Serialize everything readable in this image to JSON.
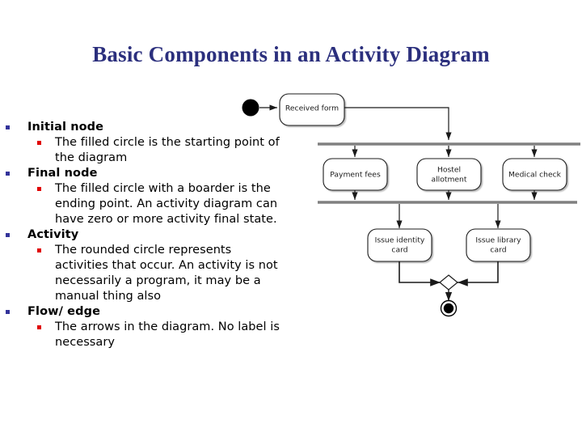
{
  "slide": {
    "title": "Basic Components in an Activity Diagram",
    "title_color": "#2b2f7d",
    "background_color": "#ffffff"
  },
  "bullets": {
    "marker_level1_color": "#33339a",
    "marker_level2_color": "#e00000",
    "items": [
      {
        "heading": "Initial node",
        "detail": "The filled circle is the starting point of the diagram"
      },
      {
        "heading": "Final node",
        "detail": "The filled circle with a boarder is the ending point. An activity diagram can have zero or more activity final state."
      },
      {
        "heading": "Activity",
        "detail": "The rounded circle represents activities that occur. An activity is not necessarily a program, it may be a manual thing also"
      },
      {
        "heading": "Flow/ edge",
        "detail": "The arrows in the diagram. No label is necessary"
      }
    ]
  },
  "diagram": {
    "type": "uml-activity-diagram",
    "stroke_color": "#1a1a1a",
    "bar_color": "#808080",
    "node_fill": "#ffffff",
    "initial_node": {
      "label": "",
      "shape": "filled-circle"
    },
    "final_node": {
      "label": "",
      "shape": "circle-with-border"
    },
    "merge_node": {
      "label": "",
      "shape": "diamond"
    },
    "fork_bar": {
      "label": "fork"
    },
    "join_bar": {
      "label": "join"
    },
    "activities": [
      {
        "id": "received-form",
        "label": "Received form",
        "lines": [
          "Received form"
        ]
      },
      {
        "id": "payment-fees",
        "label": "Payment fees",
        "lines": [
          "Payment fees"
        ]
      },
      {
        "id": "hostel-allotment",
        "label": "Hostel allotment",
        "lines": [
          "Hostel",
          "allotment"
        ]
      },
      {
        "id": "medical-check",
        "label": "Medical check",
        "lines": [
          "Medical check"
        ]
      },
      {
        "id": "issue-identity-card",
        "label": "Issue identity card",
        "lines": [
          "Issue identity",
          "card"
        ]
      },
      {
        "id": "issue-library-card",
        "label": "Issue library card",
        "lines": [
          "Issue library",
          "card"
        ]
      }
    ]
  }
}
